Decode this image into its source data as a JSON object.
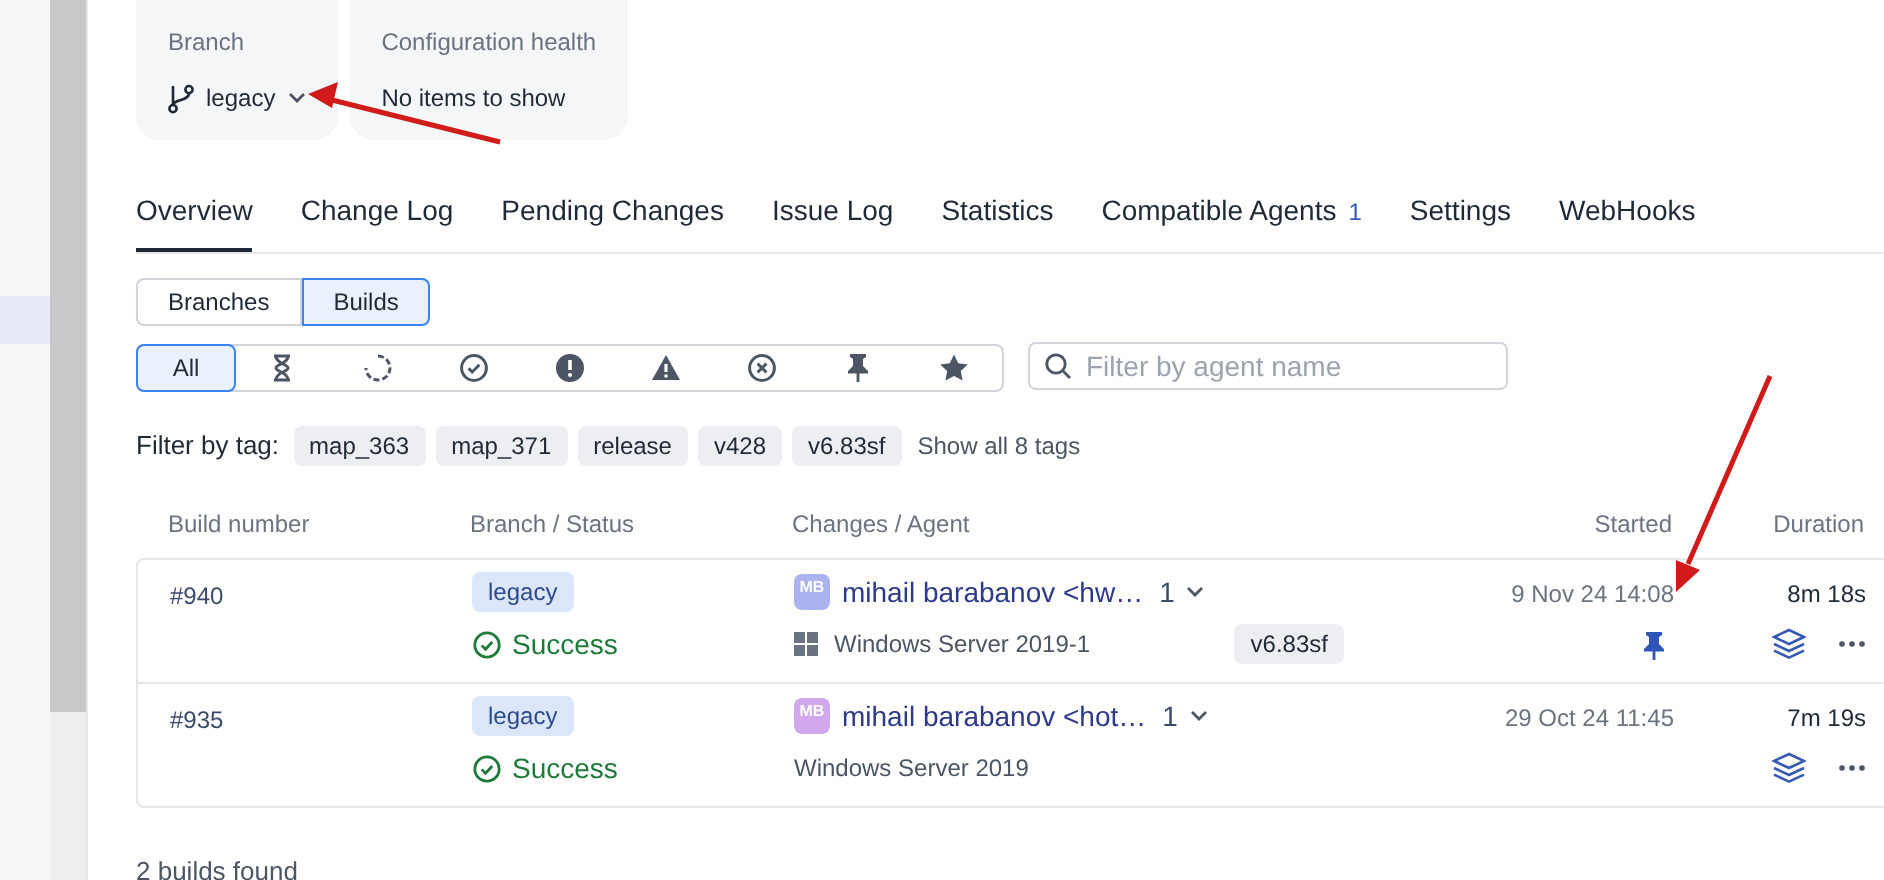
{
  "summary_cards": [
    {
      "label": "Branch",
      "kind": "branch",
      "value": "legacy"
    },
    {
      "label": "Configuration health",
      "kind": "text",
      "value": "No items to show"
    }
  ],
  "tabs": [
    {
      "label": "Overview",
      "selected": true
    },
    {
      "label": "Change Log",
      "selected": false
    },
    {
      "label": "Pending Changes",
      "selected": false
    },
    {
      "label": "Issue Log",
      "selected": false
    },
    {
      "label": "Statistics",
      "selected": false
    },
    {
      "label": "Compatible Agents",
      "count": "1",
      "selected": false
    },
    {
      "label": "Settings",
      "selected": false
    },
    {
      "label": "WebHooks",
      "selected": false
    }
  ],
  "view_toggle": [
    {
      "label": "Branches",
      "selected": false
    },
    {
      "label": "Builds",
      "selected": true
    }
  ],
  "status_filters": [
    {
      "kind": "all",
      "label": "All",
      "selected": true
    },
    {
      "kind": "queued",
      "selected": false
    },
    {
      "kind": "running",
      "selected": false
    },
    {
      "kind": "success",
      "selected": false
    },
    {
      "kind": "failed",
      "selected": false
    },
    {
      "kind": "warning",
      "selected": false
    },
    {
      "kind": "canceled",
      "selected": false
    },
    {
      "kind": "pinned",
      "selected": false
    },
    {
      "kind": "starred",
      "selected": false
    }
  ],
  "agent_search": {
    "placeholder": "Filter by agent name"
  },
  "tag_filter": {
    "label": "Filter by tag:",
    "tags": [
      "map_363",
      "map_371",
      "release",
      "v428",
      "v6.83sf"
    ],
    "show_all": "Show all 8 tags"
  },
  "table": {
    "columns": [
      "Build number",
      "Branch / Status",
      "Changes / Agent",
      "Started",
      "Duration"
    ],
    "rows": [
      {
        "number": "#940",
        "branch": "legacy",
        "status": "Success",
        "avatar": "MB",
        "color": "#aab2f0",
        "author": "mihail barabanov <hw…",
        "changes": "1",
        "agent": "Windows Server 2019-1",
        "kind": "windows-agent",
        "tag": "v6.83sf",
        "started": "9 Nov 24 14:08",
        "pinned": true,
        "duration": "8m 18s"
      },
      {
        "number": "#935",
        "branch": "legacy",
        "status": "Success",
        "avatar": "MB",
        "color": "#d2a8ec",
        "author": "mihail barabanov <hot…",
        "changes": "1",
        "agent": "Windows Server 2019",
        "kind": "plain-agent",
        "started": "29 Oct 24 11:45",
        "pinned": false,
        "duration": "7m 19s"
      }
    ]
  },
  "footer": "2 builds found"
}
